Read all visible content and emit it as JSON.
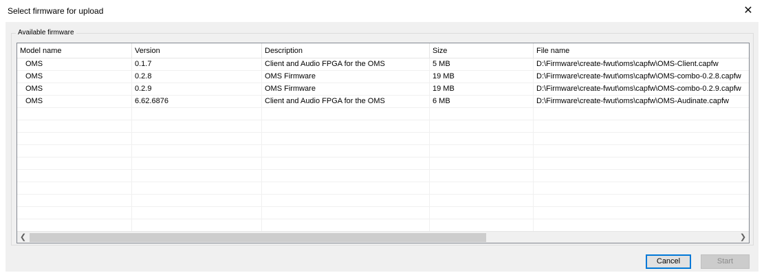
{
  "window": {
    "title": "Select firmware for upload",
    "close_glyph": "✕"
  },
  "group": {
    "legend": "Available firmware"
  },
  "table": {
    "columns": [
      {
        "label": "Model name"
      },
      {
        "label": "Version"
      },
      {
        "label": "Description"
      },
      {
        "label": "Size"
      },
      {
        "label": "File name"
      }
    ],
    "rows": [
      [
        "OMS",
        "0.1.7",
        "Client and Audio FPGA for the OMS",
        "5 MB",
        "D:\\Firmware\\create-fwut\\oms\\capfw\\OMS-Client.capfw"
      ],
      [
        "OMS",
        "0.2.8",
        "OMS Firmware",
        "19 MB",
        "D:\\Firmware\\create-fwut\\oms\\capfw\\OMS-combo-0.2.8.capfw"
      ],
      [
        "OMS",
        "0.2.9",
        "OMS Firmware",
        "19 MB",
        "D:\\Firmware\\create-fwut\\oms\\capfw\\OMS-combo-0.2.9.capfw"
      ],
      [
        "OMS",
        "6.62.6876",
        "Client and Audio FPGA for the OMS",
        "6 MB",
        "D:\\Firmware\\create-fwut\\oms\\capfw\\OMS-Audinate.capfw"
      ]
    ],
    "empty_row_count": 13
  },
  "scrollbar": {
    "left_glyph": "❮",
    "right_glyph": "❯"
  },
  "buttons": {
    "cancel": "Cancel",
    "start": "Start"
  }
}
